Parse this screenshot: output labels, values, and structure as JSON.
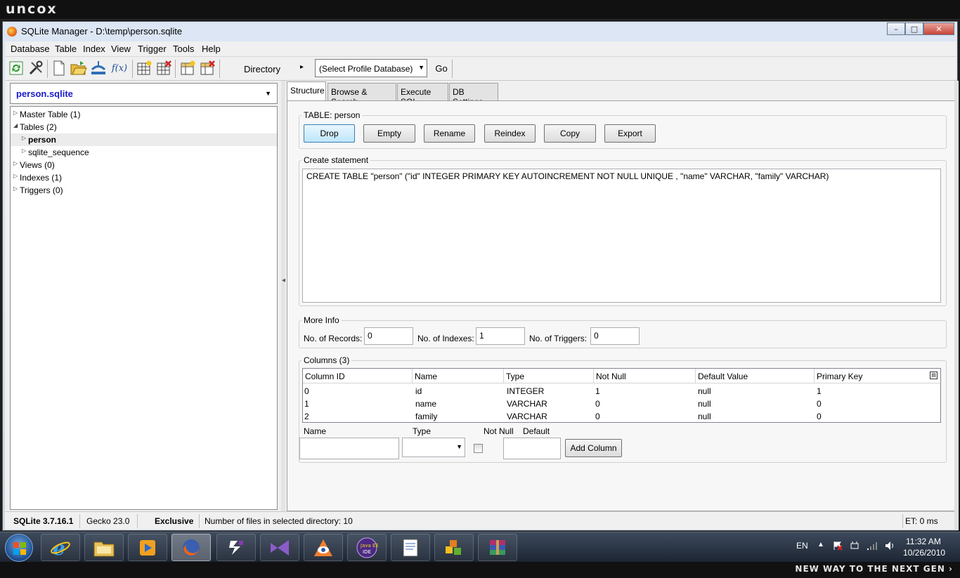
{
  "watermark": {
    "logo": "uncox",
    "tagline": "NEW WAY TO THE NEXT GEN ›"
  },
  "window": {
    "title": "SQLite Manager - D:\\temp\\person.sqlite",
    "min": "–",
    "max": "□",
    "close": "✕"
  },
  "menu": {
    "items": [
      "Database",
      "Table",
      "Index",
      "View",
      "Trigger",
      "Tools",
      "Help"
    ]
  },
  "toolbar": {
    "icons": [
      "refresh-icon",
      "tools-icon",
      "new-db-icon",
      "open-db-icon",
      "connect-icon",
      "function-icon",
      "create-table-icon",
      "drop-table-icon",
      "create-index-icon",
      "drop-index-icon"
    ],
    "function_label": "f(x)",
    "directory_label": "Directory",
    "directory_arrow": "▸",
    "profile_select": "(Select Profile Database)",
    "go_label": "Go"
  },
  "left": {
    "db_select": "person.sqlite",
    "tree": [
      {
        "label": "Master Table (1)",
        "twisty": "▷",
        "level": 0
      },
      {
        "label": "Tables (2)",
        "twisty": "◢",
        "level": 0
      },
      {
        "label": "person",
        "twisty": "▷",
        "level": 1,
        "selected": true
      },
      {
        "label": "sqlite_sequence",
        "twisty": "▷",
        "level": 1
      },
      {
        "label": "Views (0)",
        "twisty": "▷",
        "level": 0
      },
      {
        "label": "Indexes (1)",
        "twisty": "▷",
        "level": 0
      },
      {
        "label": "Triggers (0)",
        "twisty": "▷",
        "level": 0
      }
    ]
  },
  "tabs": [
    "Structure",
    "Browse & Search",
    "Execute SQL",
    "DB Settings"
  ],
  "structure": {
    "table_group_title": "TABLE: person",
    "buttons": [
      "Drop",
      "Empty",
      "Rename",
      "Reindex",
      "Copy",
      "Export"
    ],
    "create_title": "Create statement",
    "create_sql": "CREATE TABLE \"person\" (\"id\" INTEGER PRIMARY KEY  AUTOINCREMENT  NOT NULL  UNIQUE , \"name\" VARCHAR, \"family\" VARCHAR)",
    "more_info_title": "More Info",
    "records_label": "No. of Records:",
    "records_value": "0",
    "indexes_label": "No. of Indexes:",
    "indexes_value": "1",
    "triggers_label": "No. of Triggers:",
    "triggers_value": "0",
    "columns_title": "Columns (3)",
    "columns_headers": [
      "Column ID",
      "Name",
      "Type",
      "Not Null",
      "Default Value",
      "Primary Key"
    ],
    "columns_rows": [
      [
        "0",
        "id",
        "INTEGER",
        "1",
        "null",
        "1"
      ],
      [
        "1",
        "name",
        "VARCHAR",
        "0",
        "null",
        "0"
      ],
      [
        "2",
        "family",
        "VARCHAR",
        "0",
        "null",
        "0"
      ]
    ],
    "add_name_label": "Name",
    "add_type_label": "Type",
    "add_notnull_label": "Not Null",
    "add_default_label": "Default",
    "add_button": "Add Column"
  },
  "status": {
    "sqlite": "SQLite 3.7.16.1",
    "gecko": "Gecko 23.0",
    "mode": "Exclusive",
    "files": "Number of files in selected directory: 10",
    "et": "ET: 0 ms"
  },
  "taskbar": {
    "apps": [
      "ie-icon",
      "explorer-icon",
      "media-player-icon",
      "firefox-icon",
      "app-icon",
      "visual-studio-icon",
      "eye-app-icon",
      "java-ee-ide-icon",
      "notepad-icon",
      "cubes-icon",
      "winrar-icon"
    ],
    "lang": "EN",
    "time": "11:32 AM",
    "date": "10/26/2010"
  }
}
